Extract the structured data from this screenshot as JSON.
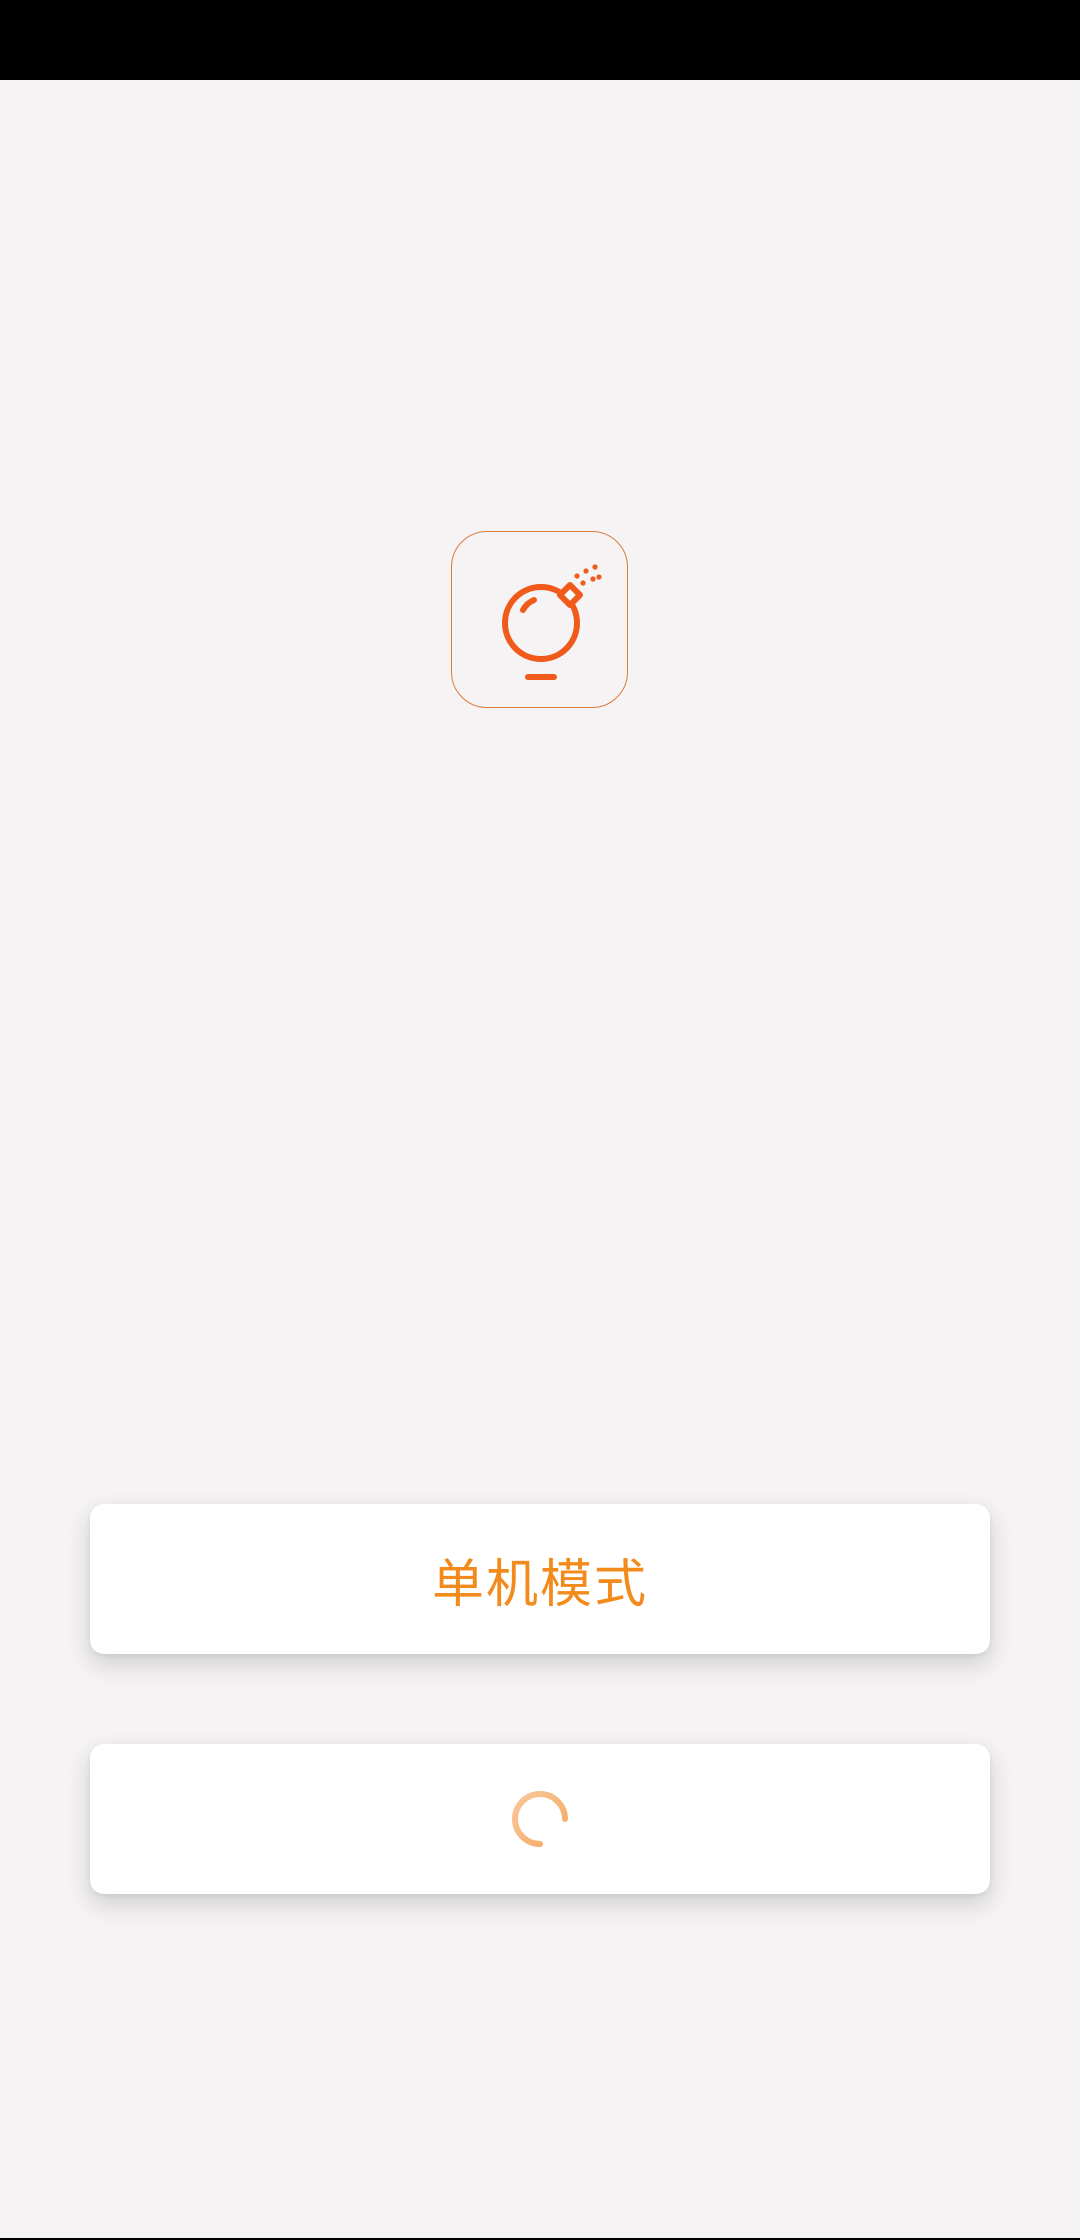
{
  "splash": {
    "logo_icon": "bomb-icon",
    "accent_color": "#f28b1c",
    "icon_color": "#f05a1a",
    "background_color": "#f5f3f4"
  },
  "actions": {
    "standalone_label": "单机模式",
    "loading_indicator": "spinner-icon"
  }
}
